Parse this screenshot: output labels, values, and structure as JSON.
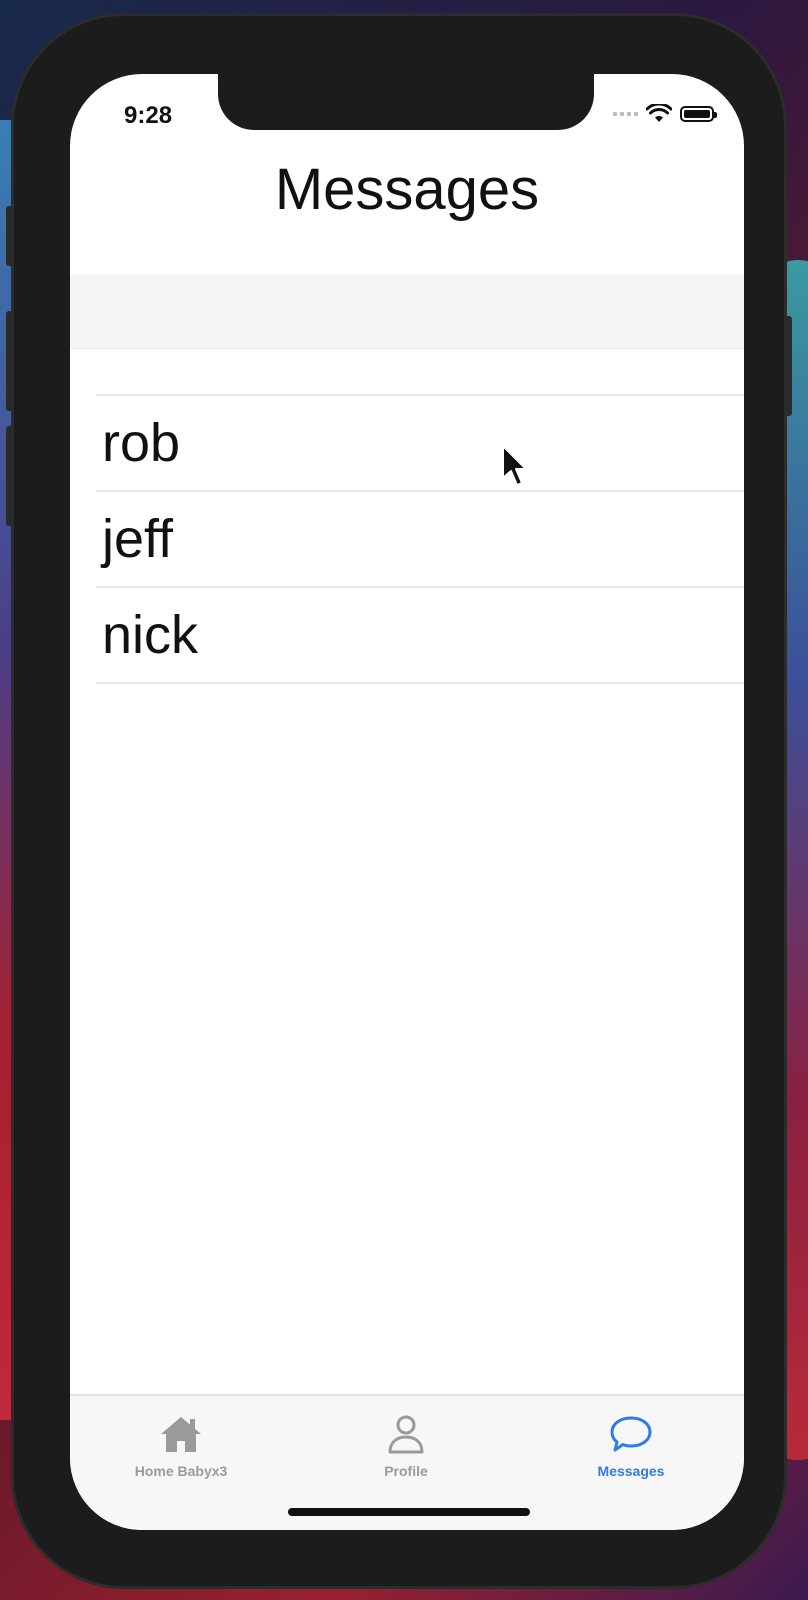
{
  "status_bar": {
    "time": "9:28"
  },
  "nav": {
    "title": "Messages"
  },
  "conversations": [
    {
      "name": "rob"
    },
    {
      "name": "jeff"
    },
    {
      "name": "nick"
    }
  ],
  "tab_bar": {
    "tabs": [
      {
        "label": "Home Babyx3",
        "icon": "house-icon",
        "active": false
      },
      {
        "label": "Profile",
        "icon": "person-icon",
        "active": false
      },
      {
        "label": "Messages",
        "icon": "chat-bubble-icon",
        "active": true
      }
    ],
    "active_color": "#2f7ce8",
    "inactive_color": "#9a9a9a"
  }
}
